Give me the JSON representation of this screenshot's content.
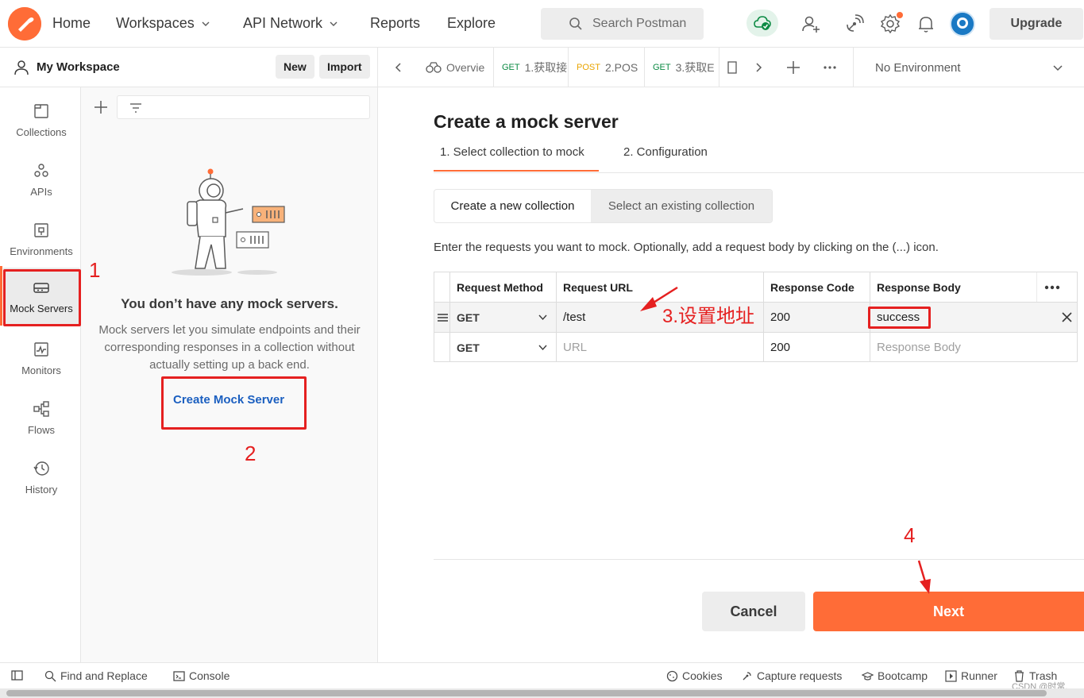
{
  "header": {
    "nav": [
      "Home",
      "Workspaces",
      "API Network",
      "Reports",
      "Explore"
    ],
    "search_placeholder": "Search Postman",
    "upgrade_label": "Upgrade",
    "brand_color": "#ff6c37"
  },
  "workspace": {
    "title": "My Workspace",
    "new_label": "New",
    "import_label": "Import"
  },
  "rail": {
    "items": [
      {
        "label": "Collections",
        "icon": "collections-icon"
      },
      {
        "label": "APIs",
        "icon": "apis-icon"
      },
      {
        "label": "Environments",
        "icon": "environments-icon"
      },
      {
        "label": "Mock Servers",
        "icon": "mock-servers-icon",
        "active": true
      },
      {
        "label": "Monitors",
        "icon": "monitors-icon"
      },
      {
        "label": "Flows",
        "icon": "flows-icon"
      },
      {
        "label": "History",
        "icon": "history-icon"
      }
    ]
  },
  "panel": {
    "empty_title": "You don’t have any mock servers.",
    "empty_desc": "Mock servers let you simulate endpoints and their corresponding responses in a collection without actually setting up a back end.",
    "create_label": "Create Mock Server"
  },
  "tabs": {
    "items": [
      {
        "method": "",
        "label": "Overvie"
      },
      {
        "method": "GET",
        "label": "1.获取接"
      },
      {
        "method": "POST",
        "label": "2.POS"
      },
      {
        "method": "GET",
        "label": "3.获取E"
      }
    ],
    "environment": "No Environment"
  },
  "form": {
    "title": "Create a mock server",
    "steps": [
      "1.  Select collection to mock",
      "2.  Configuration"
    ],
    "segments": [
      "Create a new collection",
      "Select an existing collection"
    ],
    "hint": "Enter the requests you want to mock. Optionally, add a request body by clicking on the (...) icon.",
    "columns": [
      "Request Method",
      "Request URL",
      "Response Code",
      "Response Body"
    ],
    "rows": [
      {
        "method": "GET",
        "url": "/test",
        "code": "200",
        "body": "success"
      },
      {
        "method": "GET",
        "url": "URL",
        "code": "200",
        "body": "Response Body"
      }
    ],
    "cancel_label": "Cancel",
    "next_label": "Next"
  },
  "statusbar": {
    "find_replace": "Find and Replace",
    "console": "Console",
    "cookies": "Cookies",
    "capture": "Capture requests",
    "bootcamp": "Bootcamp",
    "runner": "Runner",
    "trash": "Trash",
    "watermark": "CSDN @时常."
  },
  "annotations": {
    "n1": "1",
    "n2": "2",
    "n3": "3.设置地址",
    "n4": "4",
    "color": "#e52020"
  }
}
